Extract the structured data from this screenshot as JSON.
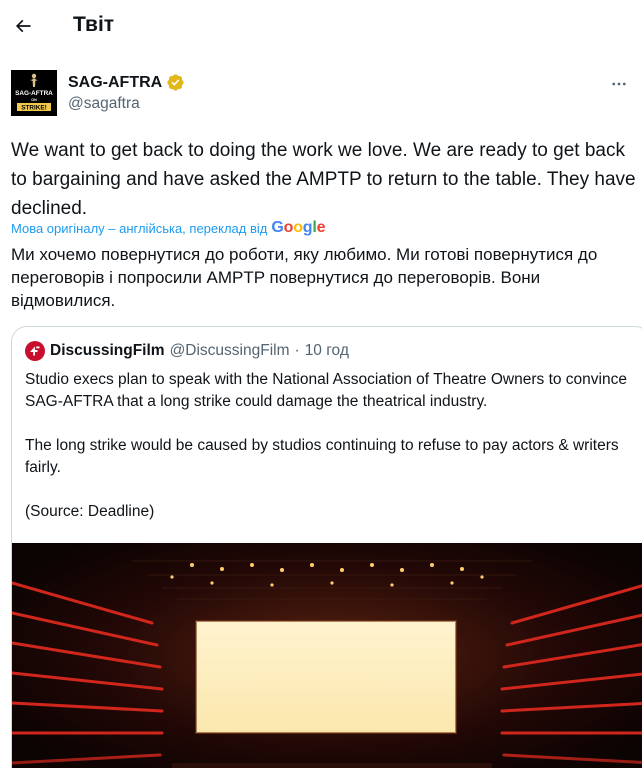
{
  "header": {
    "title": "Твіт",
    "back_icon": "arrow-left-icon"
  },
  "tweet": {
    "author": {
      "display_name": "SAG-AFTRA",
      "handle": "@sagaftra",
      "verified_badge": "gold-verified-badge-icon",
      "avatar_text": "SAG-AFTRA ON STRIKE!"
    },
    "more_icon": "more-dots-icon",
    "text": "We want to get back to doing the work we love. We are ready to get back to bargaining and have asked the AMPTP to return to the table. They have declined.",
    "translation": {
      "label": "Мова оригіналу – англійська, переклад від",
      "provider": "Google"
    },
    "translated_text": "Ми хочемо повернутися до роботи, яку любимо. Ми готові повернутися до переговорів і попросили AMPTP повернутися до переговорів. Вони відмовилися."
  },
  "quote": {
    "display_name": "DiscussingFilm",
    "handle": "@DiscussingFilm",
    "separator": "·",
    "time": "10 год",
    "paragraphs": [
      "Studio execs plan to speak with the National Association of Theatre Owners to convince SAG-AFTRA that a long strike could damage the theatrical industry.",
      "The long strike would be caused by studios continuing to refuse to pay actors & writers fairly.",
      "(Source: Deadline)"
    ],
    "media": "cinema-screen-photo"
  },
  "colors": {
    "text": "#0f1419",
    "secondary": "#536471",
    "link": "#1d9bf0",
    "border": "#cfd9de",
    "verified_gold": "#e2b719",
    "discussingfilm_red": "#c8102e"
  }
}
